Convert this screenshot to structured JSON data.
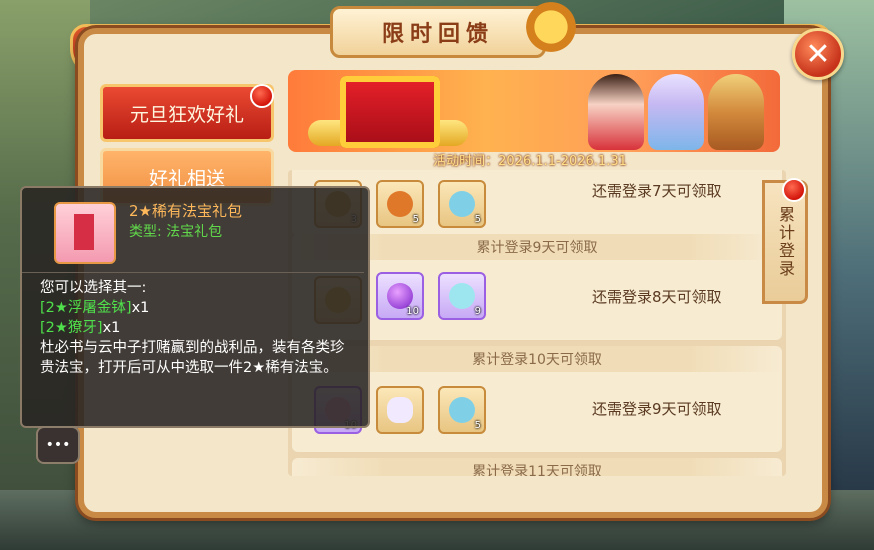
{
  "window": {
    "title": "限时回馈"
  },
  "tabs": [
    {
      "label": "元旦狂欢好礼",
      "active": true
    },
    {
      "label": "好礼相送",
      "active": false
    }
  ],
  "banner": {
    "activity_time": "活动时间：2026.1.1-2026.1.31"
  },
  "side_tab": {
    "label": "累计登录"
  },
  "rows": [
    {
      "header": "",
      "status": "还需登录7天可领取",
      "items": [
        {
          "count": "3"
        },
        {
          "count": "5"
        },
        {
          "count": "5"
        }
      ]
    },
    {
      "header": "累计登录9天可领取",
      "status": "还需登录8天可领取",
      "items": [
        {
          "count": ""
        },
        {
          "count": "10"
        },
        {
          "count": "9"
        }
      ]
    },
    {
      "header": "累计登录10天可领取",
      "status": "还需登录9天可领取",
      "items": [
        {
          "count": "10"
        },
        {
          "count": ""
        },
        {
          "count": "5"
        }
      ]
    },
    {
      "header": "累计登录11天可领取",
      "status": "",
      "items": []
    }
  ],
  "tooltip": {
    "name": "2★稀有法宝礼包",
    "type": "类型: 法宝礼包",
    "choose_text": "您可以选择其一:",
    "options": [
      {
        "bracket_open": "[",
        "name": "2★浮屠金钵",
        "bracket_close": "]",
        "qty": "x1"
      },
      {
        "bracket_open": "[",
        "name": "2★獠牙",
        "bracket_close": "]",
        "qty": "x1"
      }
    ],
    "description": "杜必书与云中子打赌赢到的战利品，装有各类珍贵法宝，打开后可从中选取一件2★稀有法宝。"
  },
  "colors": {
    "accent": "#c6321a",
    "tooltip_name": "#ffb85a",
    "tooltip_green": "#4fe04b"
  }
}
